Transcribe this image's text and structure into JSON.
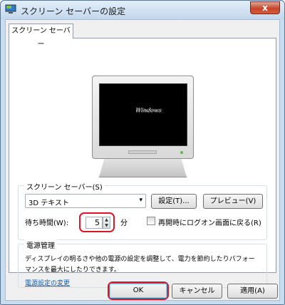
{
  "window": {
    "title": "スクリーン セーバーの設定",
    "close_glyph": "x",
    "icon": "display-properties-icon"
  },
  "tab": {
    "label": "スクリーン セーバー"
  },
  "preview": {
    "screen_text": "Windows"
  },
  "saver_group": {
    "legend": "スクリーン セーバー(S)",
    "selected": "3D テキスト",
    "dropdown_glyph": "▾",
    "settings_button": "設定(T)...",
    "preview_button": "プレビュー(V)",
    "wait_label": "待ち時間(W):",
    "wait_value": "5",
    "wait_unit": "分",
    "resume_label": "再開時にログオン画面に戻る(R)",
    "resume_checked": false,
    "spin_up_glyph": "▲",
    "spin_down_glyph": "▼"
  },
  "power_group": {
    "legend": "電源管理",
    "description": "ディスプレイの明るさや他の電源の設定を調整して、電力を節約したりパフォーマンスを最大にしたりできます。",
    "link": "電源設定の変更"
  },
  "footer": {
    "ok": "OK",
    "cancel": "キャンセル",
    "apply": "適用(A)"
  },
  "colors": {
    "highlight": "#e0152a",
    "link": "#0f5fb4",
    "title_bar": "#c2d7ed"
  }
}
